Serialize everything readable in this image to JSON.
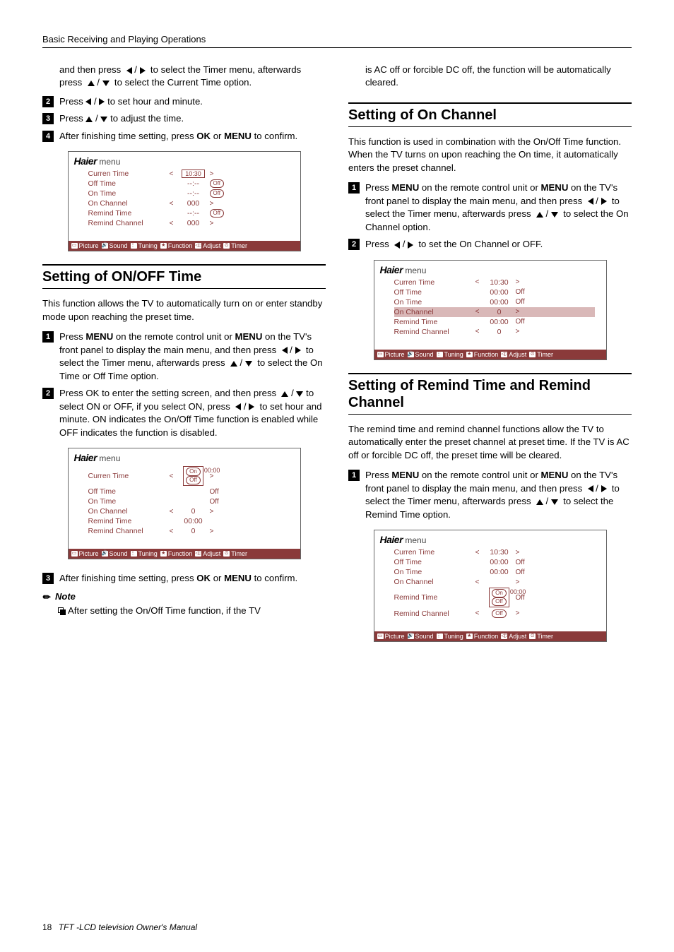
{
  "header": {
    "title": "Basic Receiving and Playing Operations"
  },
  "left": {
    "cont1": "and then press",
    "cont1b": "to select the Timer menu, afterwards press",
    "cont1c": "to select the Current Time option.",
    "step2": "Press",
    "step2b": "to set hour and minute.",
    "step3": "Press",
    "step3b": "to adjust the time.",
    "step4": "After finishing time setting, press",
    "step4b": "or",
    "step4c": "to confirm.",
    "ok": "OK",
    "menu": "MENU",
    "section1": "Setting of ON/OFF Time",
    "para1": "This function allows the TV to automatically turn on or enter standby mode upon reaching the preset time.",
    "s1step1a": "Press",
    "s1step1b": "on the remote control unit or",
    "s1step1c": "on the TV's front panel to display the main menu, and then press",
    "s1step1d": "to select the Timer menu, afterwards press",
    "s1step1e": "to select the On Time or Off Time option.",
    "s1step2a": "Press OK to enter the setting screen, and then press",
    "s1step2b": "to select ON or OFF, if you select ON, press",
    "s1step2c": "to set hour and minute. ON indicates the On/Off Time function is enabled while OFF indicates the function is disabled.",
    "s1step3": "After finishing time setting, press",
    "s1step3b": "or",
    "s1step3c": "to confirm.",
    "noteHead": "Note",
    "noteBody": "After setting the On/Off Time function, if the TV"
  },
  "right": {
    "cont": "is AC off or forcible DC off, the function will be automatically cleared.",
    "section2": "Setting of On Channel",
    "para2": "This function is used in combination with the On/Off Time function. When the TV turns on upon reaching the On time, it automatically enters the preset channel.",
    "s2step1a": "Press",
    "s2step1b": "on the remote control unit or",
    "s2step1c": "on the TV's front panel to display the main menu, and then press",
    "s2step1d": "to select the Timer menu, afterwards press",
    "s2step1e": "to select the On Channel option.",
    "s2step2": "Press",
    "s2step2b": "to set the On Channel or OFF.",
    "section3": "Setting of Remind Time and Remind Channel",
    "para3": "The remind time and remind channel functions allow the TV to automatically enter the preset channel at preset time. If the TV is AC off or forcible DC off, the preset time will be cleared.",
    "s3step1a": "Press",
    "s3step1b": "on the remote control unit or",
    "s3step1c": "on the TV's front panel to display the main menu, and then press",
    "s3step1d": "to select the Timer menu, afterwards press",
    "s3step1e": "to select the Remind Time option."
  },
  "menuBrand": "Haier",
  "menuWord": "menu",
  "menu1": {
    "rows": [
      {
        "label": "Curren Time",
        "left": "<",
        "val": "10:30",
        "right": ">",
        "boxed": true
      },
      {
        "label": "Off Time",
        "left": "",
        "val": "--:--",
        "right": "Off",
        "pill": true
      },
      {
        "label": "On Time",
        "left": "",
        "val": "--:--",
        "right": "Off",
        "pill": true
      },
      {
        "label": "On Channel",
        "left": "<",
        "val": "000",
        "right": ">"
      },
      {
        "label": "Remind Time",
        "left": "",
        "val": "--:--",
        "right": "Off",
        "pill": true
      },
      {
        "label": "Remind Channel",
        "left": "<",
        "val": "000",
        "right": ">"
      }
    ]
  },
  "menu2": {
    "rows": [
      {
        "label": "Curren Time",
        "left": "<",
        "val": "",
        "right": ">",
        "onoff": true,
        "time": "00:00"
      },
      {
        "label": "Off Time",
        "left": "",
        "val": "",
        "right": "Off"
      },
      {
        "label": "On Time",
        "left": "",
        "val": "",
        "right": "Off"
      },
      {
        "label": "On Channel",
        "left": "<",
        "val": "0",
        "right": ">"
      },
      {
        "label": "Remind Time",
        "left": "",
        "val": "00:00",
        "right": ""
      },
      {
        "label": "Remind Channel",
        "left": "<",
        "val": "0",
        "right": ">"
      }
    ]
  },
  "menu3": {
    "rows": [
      {
        "label": "Curren Time",
        "left": "<",
        "val": "10:30",
        "right": ">"
      },
      {
        "label": "Off Time",
        "left": "",
        "val": "00:00",
        "right": "Off"
      },
      {
        "label": "On Time",
        "left": "",
        "val": "00:00",
        "right": "Off"
      },
      {
        "label": "On Channel",
        "left": "<",
        "val": "0",
        "right": ">",
        "hl": true
      },
      {
        "label": "Remind Time",
        "left": "",
        "val": "00:00",
        "right": "Off"
      },
      {
        "label": "Remind Channel",
        "left": "<",
        "val": "0",
        "right": ">"
      }
    ]
  },
  "menu4": {
    "rows": [
      {
        "label": "Curren Time",
        "left": "<",
        "val": "10:30",
        "right": ">"
      },
      {
        "label": "Off Time",
        "left": "",
        "val": "00:00",
        "right": "Off"
      },
      {
        "label": "On Time",
        "left": "",
        "val": "00:00",
        "right": "Off"
      },
      {
        "label": "On Channel",
        "left": "<",
        "val": "",
        "right": ">"
      },
      {
        "label": "Remind Time",
        "left": "",
        "val": "",
        "right": "Off",
        "onoff": true,
        "time": "00:00"
      },
      {
        "label": "Remind Channel",
        "left": "<",
        "val": "Off",
        "right": ">",
        "pillval": true
      }
    ]
  },
  "menuFooter": {
    "items": [
      "Picture",
      "Sound",
      "Tuning",
      "Function",
      "Adjust",
      "Timer"
    ]
  },
  "footer": {
    "page": "18",
    "text": "TFT -LCD television  Owner's Manual"
  },
  "onLabel": "On",
  "offLabel": "Off"
}
